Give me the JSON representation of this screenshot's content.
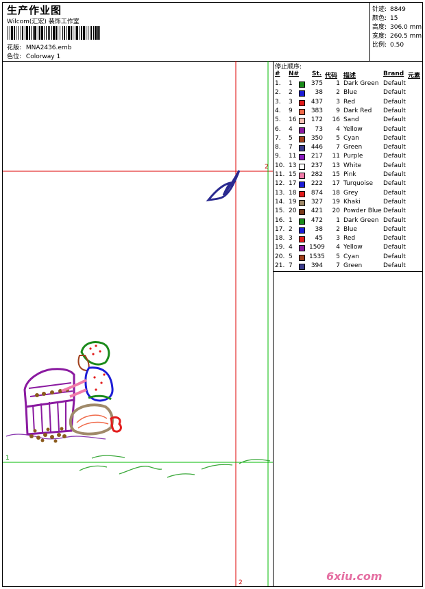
{
  "header": {
    "title": "生产作业图",
    "studio": "Wilcom(汇宏) 装饰工作室",
    "design_label": "花版:",
    "design_value": "MNA2436.emb",
    "colorway_label": "色位:",
    "colorway_value": "Colorway 1"
  },
  "stats": [
    {
      "label": "针迹:",
      "value": "8849"
    },
    {
      "label": "颜色:",
      "value": "15"
    },
    {
      "label": "高度:",
      "value": "306.0 mm"
    },
    {
      "label": "宽度:",
      "value": "260.5 mm"
    },
    {
      "label": "比例:",
      "value": "0.50"
    }
  ],
  "stop_sequence": {
    "title": "停止顺序:",
    "headers": {
      "num": "#",
      "n": "N#",
      "st": "St.",
      "code": "代码",
      "desc": "描述",
      "brand": "Brand",
      "elem": "元素"
    },
    "rows": [
      {
        "idx": "1.",
        "n": "1",
        "color": "#1a8a1a",
        "st": "375",
        "code": "1",
        "desc": "Dark Green",
        "brand": "Default"
      },
      {
        "idx": "2.",
        "n": "2",
        "color": "#1c1cd6",
        "st": "38",
        "code": "2",
        "desc": "Blue",
        "brand": "Default"
      },
      {
        "idx": "3.",
        "n": "3",
        "color": "#e21c1c",
        "st": "437",
        "code": "3",
        "desc": "Red",
        "brand": "Default"
      },
      {
        "idx": "4.",
        "n": "9",
        "color": "#f06a4a",
        "st": "383",
        "code": "9",
        "desc": "Dark Red",
        "brand": "Default"
      },
      {
        "idx": "5.",
        "n": "16",
        "color": "#f5c4b8",
        "st": "172",
        "code": "16",
        "desc": "Sand",
        "brand": "Default"
      },
      {
        "idx": "6.",
        "n": "4",
        "color": "#8a1aa0",
        "st": "73",
        "code": "4",
        "desc": "Yellow",
        "brand": "Default"
      },
      {
        "idx": "7.",
        "n": "5",
        "color": "#a0401c",
        "st": "350",
        "code": "5",
        "desc": "Cyan",
        "brand": "Default"
      },
      {
        "idx": "8.",
        "n": "7",
        "color": "#3a3a8a",
        "st": "446",
        "code": "7",
        "desc": "Green",
        "brand": "Default"
      },
      {
        "idx": "9.",
        "n": "11",
        "color": "#8a1ac0",
        "st": "217",
        "code": "11",
        "desc": "Purple",
        "brand": "Default"
      },
      {
        "idx": "10.",
        "n": "13",
        "color": "#ffffff",
        "st": "237",
        "code": "13",
        "desc": "White",
        "brand": "Default"
      },
      {
        "idx": "11.",
        "n": "15",
        "color": "#f07aa8",
        "st": "282",
        "code": "15",
        "desc": "Pink",
        "brand": "Default"
      },
      {
        "idx": "12.",
        "n": "17",
        "color": "#1c1cd6",
        "st": "222",
        "code": "17",
        "desc": "Turquoise",
        "brand": "Default"
      },
      {
        "idx": "13.",
        "n": "18",
        "color": "#e21c1c",
        "st": "874",
        "code": "18",
        "desc": "Grey",
        "brand": "Default"
      },
      {
        "idx": "14.",
        "n": "19",
        "color": "#a08a6a",
        "st": "327",
        "code": "19",
        "desc": "Khaki",
        "brand": "Default"
      },
      {
        "idx": "15.",
        "n": "20",
        "color": "#7a3a1a",
        "st": "421",
        "code": "20",
        "desc": "Powder Blue",
        "brand": "Default"
      },
      {
        "idx": "16.",
        "n": "1",
        "color": "#1a8a1a",
        "st": "472",
        "code": "1",
        "desc": "Dark Green",
        "brand": "Default"
      },
      {
        "idx": "17.",
        "n": "2",
        "color": "#1c1cd6",
        "st": "38",
        "code": "2",
        "desc": "Blue",
        "brand": "Default"
      },
      {
        "idx": "18.",
        "n": "3",
        "color": "#e21c1c",
        "st": "45",
        "code": "3",
        "desc": "Red",
        "brand": "Default"
      },
      {
        "idx": "19.",
        "n": "4",
        "color": "#8a1aa0",
        "st": "1509",
        "code": "4",
        "desc": "Yellow",
        "brand": "Default"
      },
      {
        "idx": "20.",
        "n": "5",
        "color": "#a0401c",
        "st": "1535",
        "code": "5",
        "desc": "Cyan",
        "brand": "Default"
      },
      {
        "idx": "21.",
        "n": "7",
        "color": "#3a3a8a",
        "st": "394",
        "code": "7",
        "desc": "Green",
        "brand": "Default"
      }
    ]
  },
  "markers": {
    "red_h": "2",
    "red_v": "2",
    "green_h": "1"
  },
  "watermark": {
    "site": "6xiu.com"
  }
}
